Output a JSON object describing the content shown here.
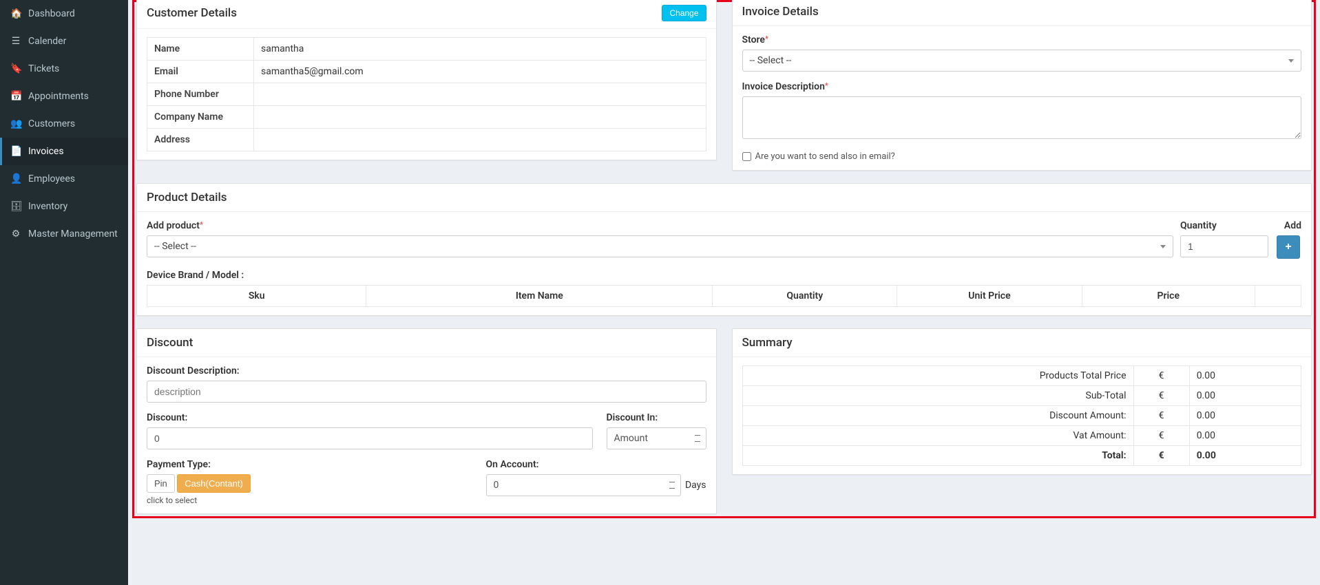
{
  "sidebar": {
    "items": [
      {
        "icon": "🏠",
        "label": "Dashboard"
      },
      {
        "icon": "☰",
        "label": "Calender"
      },
      {
        "icon": "🔖",
        "label": "Tickets"
      },
      {
        "icon": "📅",
        "label": "Appointments"
      },
      {
        "icon": "👥",
        "label": "Customers"
      },
      {
        "icon": "📄",
        "label": "Invoices"
      },
      {
        "icon": "👤",
        "label": "Employees"
      },
      {
        "icon": "🗄",
        "label": "Inventory"
      },
      {
        "icon": "⚙",
        "label": "Master Management"
      }
    ],
    "active_index": 5
  },
  "customer_card": {
    "title": "Customer Details",
    "change_btn": "Change",
    "rows": {
      "name_label": "Name",
      "name_value": "samantha",
      "email_label": "Email",
      "email_value": "samantha5@gmail.com",
      "phone_label": "Phone Number",
      "phone_value": "",
      "company_label": "Company Name",
      "company_value": "",
      "address_label": "Address",
      "address_value": ""
    }
  },
  "invoice_card": {
    "title": "Invoice Details",
    "store_label": "Store",
    "store_select": "-- Select --",
    "desc_label": "Invoice Description",
    "email_checkbox_label": "Are you want to send also in email?"
  },
  "product_card": {
    "title": "Product Details",
    "add_product_label": "Add product",
    "product_select": "-- Select --",
    "quantity_label": "Quantity",
    "quantity_value": "1",
    "add_label": "Add",
    "add_icon": "+",
    "device_label": "Device Brand / Model :",
    "cols": {
      "sku": "Sku",
      "item_name": "Item Name",
      "quantity": "Quantity",
      "unit_price": "Unit Price",
      "price": "Price"
    }
  },
  "discount_card": {
    "title": "Discount",
    "desc_label": "Discount Description:",
    "desc_placeholder": "description",
    "discount_label": "Discount:",
    "discount_value": "0",
    "discount_in_label": "Discount In:",
    "discount_in_value": "Amount",
    "payment_type_label": "Payment Type:",
    "pin_btn": "Pin",
    "cash_btn": "Cash(Contant)",
    "click_hint": "click to select",
    "on_account_label": "On Account:",
    "on_account_value": "0",
    "days_suffix": "Days"
  },
  "summary_card": {
    "title": "Summary",
    "currency": "€",
    "rows": [
      {
        "label": "Products Total Price",
        "value": "0.00"
      },
      {
        "label": "Sub-Total",
        "value": "0.00"
      },
      {
        "label": "Discount Amount:",
        "value": "0.00"
      },
      {
        "label": "Vat Amount:",
        "value": "0.00"
      },
      {
        "label": "Total:",
        "value": "0.00"
      }
    ]
  }
}
